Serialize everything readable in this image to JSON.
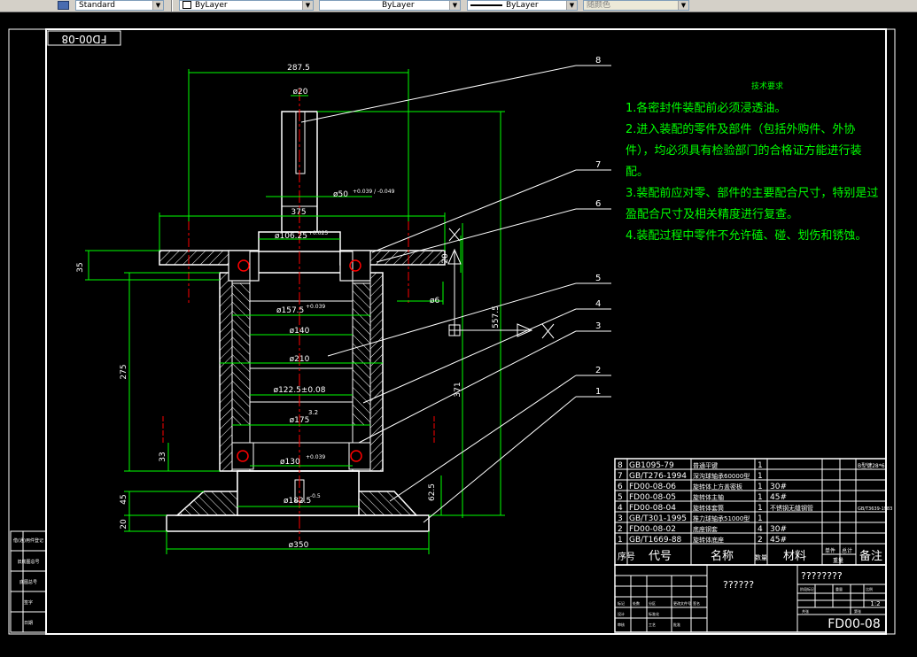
{
  "toolbar": {
    "text_style": "Standard",
    "layer": "ByLayer",
    "linetype": "ByLayer",
    "lineweight": "ByLayer",
    "plot_style": "随颜色"
  },
  "drawing": {
    "frame_tag": "FD00-08",
    "dimensions": {
      "d287": "287.5",
      "d20": "ø20",
      "d50": "ø50",
      "d50_tol": "+0.039 / -0.049",
      "d375": "375",
      "d106": "ø106.25",
      "d106_tol": "+0.025",
      "d35": "35",
      "d20b": "20",
      "d6": "ø6",
      "d157": "ø157.5",
      "d157_tol": "+0.039",
      "d140": "ø140",
      "d210": "ø210",
      "d122": "ø122.5±0.08",
      "d175": "ø175",
      "d130": "ø130",
      "d130_tol": "+0.039",
      "d182": "ø182.5",
      "d182_tol": "-0.5",
      "d275": "275",
      "d33": "33",
      "d45": "45",
      "d20c": "20",
      "d350": "ø350",
      "d557": "557.5",
      "d371": "371",
      "d625": "62.5",
      "r32": "3.2"
    },
    "balloons": [
      "8",
      "7",
      "6",
      "5",
      "4",
      "3",
      "2",
      "1"
    ]
  },
  "tech_req": {
    "title": "技术要求",
    "lines": [
      "1.各密封件装配前必须浸透油。",
      "2.进入装配的零件及部件（包括外购件、外协",
      "件），均必须具有检验部门的合格证方能进行装",
      "配。",
      "3.装配前应对零、部件的主要配合尺寸，特别是过",
      "盈配合尺寸及相关精度进行复查。",
      "4.装配过程中零件不允许磕、碰、划伤和锈蚀。"
    ]
  },
  "bom": {
    "rows": [
      {
        "no": "8",
        "code": "GB1095-79",
        "name": "普通平键",
        "qty": "1",
        "mat": "",
        "note": "B型键28*6"
      },
      {
        "no": "7",
        "code": "GB/T276-1994",
        "name": "深沟球轴承60000型",
        "qty": "1",
        "mat": "",
        "note": ""
      },
      {
        "no": "6",
        "code": "FD00-08-06",
        "name": "旋转体上方盖密板",
        "qty": "1",
        "mat": "30#",
        "note": ""
      },
      {
        "no": "5",
        "code": "FD00-08-05",
        "name": "旋转体主轴",
        "qty": "1",
        "mat": "45#",
        "note": ""
      },
      {
        "no": "4",
        "code": "FD00-08-04",
        "name": "旋转体套筒",
        "qty": "1",
        "mat": "不锈钢无缝钢管",
        "note": "GB/T3639-1983"
      },
      {
        "no": "3",
        "code": "GB/T301-1995",
        "name": "推力球轴承51000型",
        "qty": "1",
        "mat": "",
        "note": ""
      },
      {
        "no": "2",
        "code": "FD00-08-02",
        "name": "底座钢套",
        "qty": "4",
        "mat": "30#",
        "note": ""
      },
      {
        "no": "1",
        "code": "GB/T1669-88",
        "name": "旋转体底座",
        "qty": "2",
        "mat": "45#",
        "note": ""
      }
    ],
    "header": {
      "no": "序号",
      "code": "代号",
      "name": "名称",
      "qty": "数量",
      "mat": "材料",
      "single": "单件",
      "total": "总计",
      "weight": "重量",
      "note": "备注"
    }
  },
  "title_block": {
    "name_placeholder": "??????",
    "company_placeholder": "????????",
    "scale": "1:2",
    "drawing_no": "FD00-08",
    "small_labels": [
      "标记",
      "处数",
      "分区",
      "更改文件号",
      "签名",
      "年月日",
      "设计",
      "标准化",
      "审核",
      "工艺",
      "批准",
      "阶段标记",
      "重量",
      "比例",
      "共张",
      "第张"
    ]
  },
  "left_strip": {
    "labels": [
      "借(通)用件登记",
      "旧底图总号",
      "底图总号",
      "签字",
      "日期"
    ]
  },
  "colors": {
    "frame": "#ffffff",
    "dim": "#00ff00",
    "center": "#ff0000",
    "hatch": "#ffffff",
    "tech_text": "#00ff00"
  }
}
